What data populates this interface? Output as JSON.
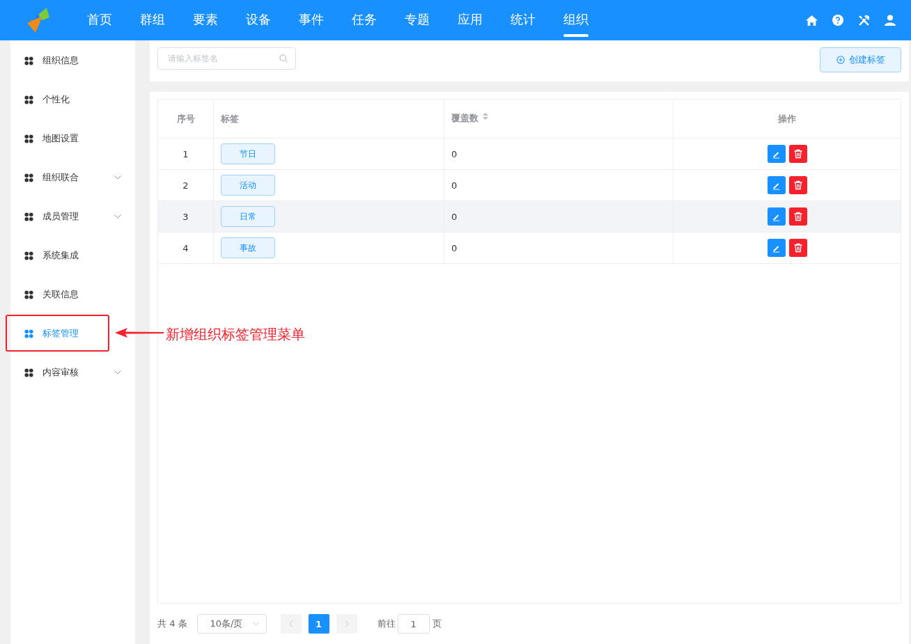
{
  "nav": {
    "items": [
      {
        "label": "首页",
        "selected": false
      },
      {
        "label": "群组",
        "selected": false
      },
      {
        "label": "要素",
        "selected": false
      },
      {
        "label": "设备",
        "selected": false
      },
      {
        "label": "事件",
        "selected": false
      },
      {
        "label": "任务",
        "selected": false
      },
      {
        "label": "专题",
        "selected": false
      },
      {
        "label": "应用",
        "selected": false
      },
      {
        "label": "统计",
        "selected": false
      },
      {
        "label": "组织",
        "selected": true
      }
    ]
  },
  "sidebar": {
    "items": [
      {
        "label": "组织信息",
        "selected": false,
        "expandable": false
      },
      {
        "label": "个性化",
        "selected": false,
        "expandable": false
      },
      {
        "label": "地图设置",
        "selected": false,
        "expandable": false
      },
      {
        "label": "组织联合",
        "selected": false,
        "expandable": true
      },
      {
        "label": "成员管理",
        "selected": false,
        "expandable": true
      },
      {
        "label": "系统集成",
        "selected": false,
        "expandable": false
      },
      {
        "label": "关联信息",
        "selected": false,
        "expandable": false
      },
      {
        "label": "标签管理",
        "selected": true,
        "expandable": false
      },
      {
        "label": "内容审核",
        "selected": false,
        "expandable": true
      }
    ]
  },
  "toolbar": {
    "search": {
      "placeholder": "请输入标签名"
    },
    "create_button": "创建标签"
  },
  "table": {
    "columns": [
      "序号",
      "标签",
      "覆盖数",
      "操作"
    ],
    "rows": [
      {
        "index": "1",
        "tag": "节日",
        "count": "0",
        "highlighted": false
      },
      {
        "index": "2",
        "tag": "活动",
        "count": "0",
        "highlighted": false
      },
      {
        "index": "3",
        "tag": "日常",
        "count": "0",
        "highlighted": true
      },
      {
        "index": "4",
        "tag": "事故",
        "count": "0",
        "highlighted": false
      }
    ]
  },
  "pagination": {
    "total": "共 4 条",
    "page_size": "10条/页",
    "pages": [
      {
        "label": "1",
        "selected": true
      }
    ],
    "goto_label": "前往",
    "goto_value": "1",
    "goto_suffix": "页"
  },
  "annotation": {
    "text": "新增组织标签管理菜单"
  }
}
